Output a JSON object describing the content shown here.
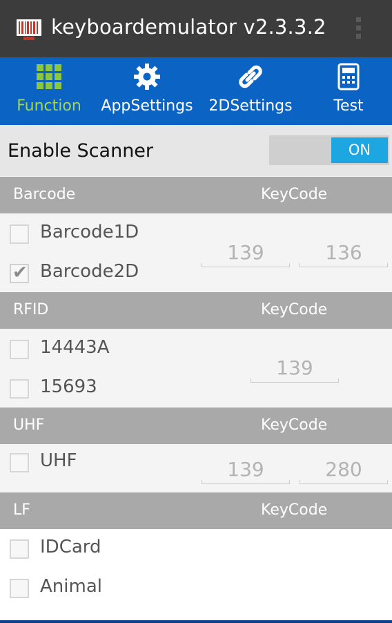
{
  "app": {
    "title": "keyboardemulator v2.3.3.2",
    "icon": "barcode-app-icon",
    "colors": {
      "actionbar": "#3c3c3c",
      "tabbar": "#0b63c4",
      "active_tab": "#a2d45e",
      "toggle_on": "#1ea6e2",
      "section_header": "#a9a9a9"
    }
  },
  "tabs": [
    {
      "label": "Function",
      "icon": "grid-icon",
      "active": true
    },
    {
      "label": "AppSettings",
      "icon": "gear-icon",
      "active": false
    },
    {
      "label": "2DSettings",
      "icon": "link-icon",
      "active": false
    },
    {
      "label": "Test",
      "icon": "calculator-icon",
      "active": false
    }
  ],
  "scanner": {
    "label": "Enable Scanner",
    "toggle_text": "ON",
    "enabled": true
  },
  "barcode": {
    "header": "Barcode",
    "keycode_header": "KeyCode",
    "items": [
      {
        "label": "Barcode1D",
        "checked": false
      },
      {
        "label": "Barcode2D",
        "checked": true
      }
    ],
    "keycodes": [
      "139",
      "136"
    ]
  },
  "rfid": {
    "header": "RFID",
    "keycode_header": "KeyCode",
    "items": [
      {
        "label": "14443A",
        "checked": false
      },
      {
        "label": "15693",
        "checked": false
      }
    ],
    "keycodes": [
      "139"
    ]
  },
  "uhf": {
    "header": "UHF",
    "keycode_header": "KeyCode",
    "items": [
      {
        "label": "UHF",
        "checked": false
      }
    ],
    "keycodes": [
      "139",
      "280"
    ]
  },
  "lf": {
    "header": "LF",
    "keycode_header": "KeyCode",
    "items": [
      {
        "label": "IDCard",
        "checked": false
      },
      {
        "label": "Animal",
        "checked": false
      }
    ]
  }
}
